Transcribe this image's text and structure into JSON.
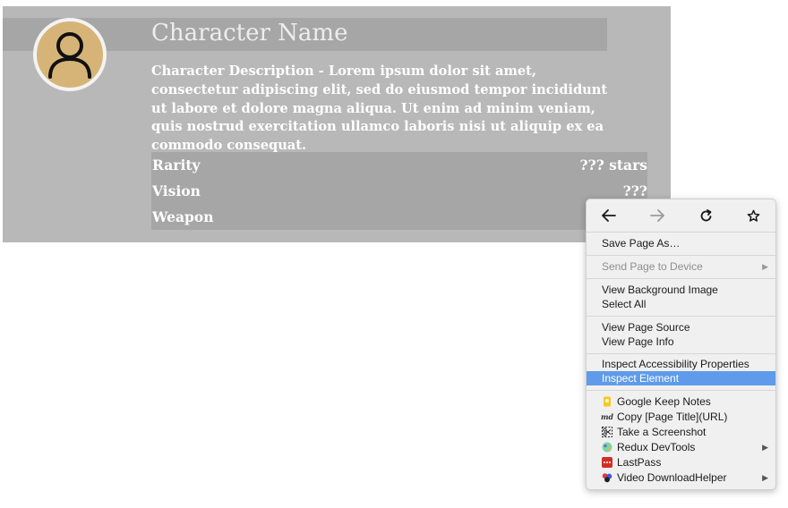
{
  "character": {
    "name": "Character Name",
    "description": "Character Description - Lorem ipsum dolor sit amet, consectetur adipiscing elit, sed do eiusmod tempor incididunt ut labore et dolore magna aliqua. Ut enim ad minim veniam, quis nostrud exercitation ullamco laboris nisi ut aliquip ex ea commodo consequat.",
    "avatar_icon": "user-icon",
    "stats": [
      {
        "label": "Rarity",
        "value": "??? stars"
      },
      {
        "label": "Vision",
        "value": "???"
      },
      {
        "label": "Weapon",
        "value": ""
      }
    ]
  },
  "context_menu": {
    "nav": {
      "back_icon": "arrow-left-icon",
      "forward_icon": "arrow-right-icon",
      "reload_icon": "reload-icon",
      "bookmark_icon": "star-icon"
    },
    "items": {
      "save_page_as": "Save Page As…",
      "send_page_to_device": "Send Page to Device",
      "view_background_image": "View Background Image",
      "select_all": "Select All",
      "view_page_source": "View Page Source",
      "view_page_info": "View Page Info",
      "inspect_accessibility": "Inspect Accessibility Properties",
      "inspect_element": "Inspect Element"
    },
    "extensions": [
      {
        "label": "Google Keep Notes",
        "icon": "google-keep-icon",
        "submenu": false
      },
      {
        "label": "Copy [Page Title](URL)",
        "icon": "markdown-icon",
        "submenu": false
      },
      {
        "label": "Take a Screenshot",
        "icon": "scissors-icon",
        "submenu": false
      },
      {
        "label": "Redux DevTools",
        "icon": "redux-icon",
        "submenu": true
      },
      {
        "label": "LastPass",
        "icon": "lastpass-icon",
        "submenu": false
      },
      {
        "label": "Video DownloadHelper",
        "icon": "video-downloadhelper-icon",
        "submenu": true
      }
    ]
  },
  "colors": {
    "card_bg": "#b8b8b8",
    "panel_bg": "#a6a6a6",
    "avatar_bg": "#d6b478",
    "menu_highlight": "#5f9bea"
  }
}
